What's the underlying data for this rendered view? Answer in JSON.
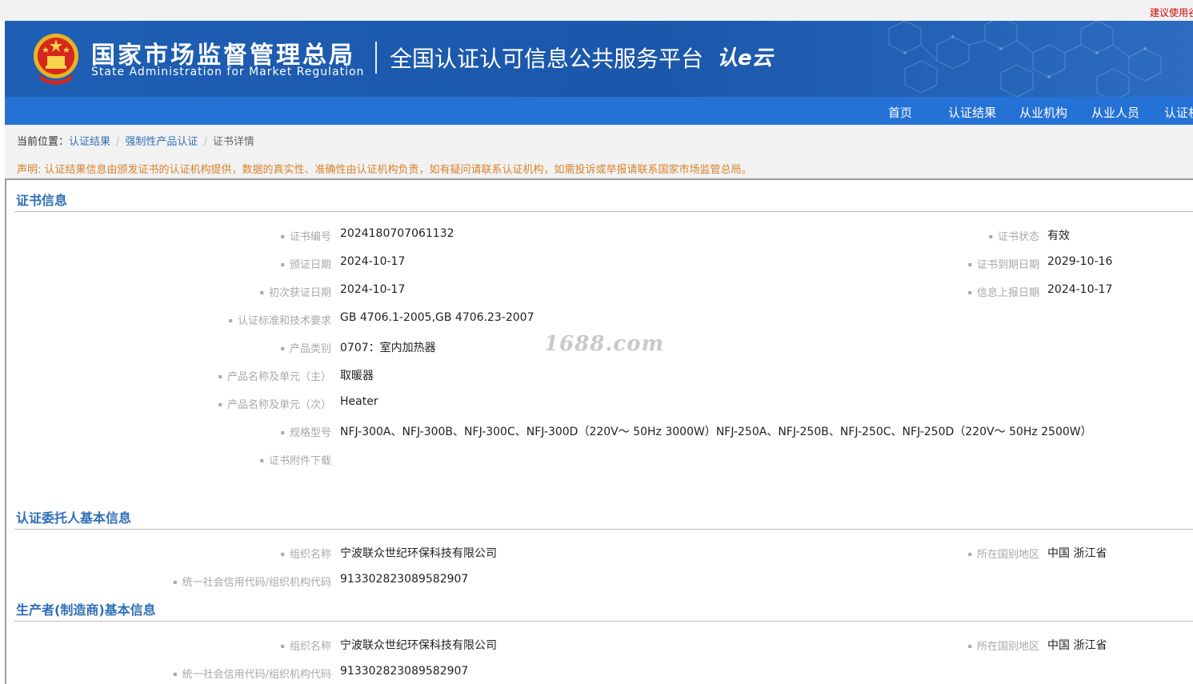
{
  "topstrip": {
    "tip": "建议使用谷"
  },
  "header": {
    "org_cn": "国家市场监督管理总局",
    "org_en": "State Administration  for  Market Regulation",
    "platform": "全国认证认可信息公共服务平台",
    "logo_text": "认e云"
  },
  "nav": {
    "items": [
      {
        "label": "首页"
      },
      {
        "label": "认证结果"
      },
      {
        "label": "从业机构"
      },
      {
        "label": "从业人员"
      },
      {
        "label": "认证机"
      }
    ]
  },
  "breadcrumb": {
    "prefix": "当前位置：",
    "items": [
      {
        "label": "认证结果"
      },
      {
        "label": "强制性产品认证"
      },
      {
        "label": "证书详情"
      }
    ]
  },
  "notice": "声明: 认证结果信息由颁发证书的认证机构提供，数据的真实性、准确性由认证机构负责，如有疑问请联系认证机构，如需投诉或举报请联系国家市场监管总局。",
  "watermark": "1688.com",
  "certificate": {
    "title": "证书信息",
    "cert_no_label": "证书编号",
    "cert_no": "2024180707061132",
    "status_label": "证书状态",
    "status": "有效",
    "issue_date_label": "颁证日期",
    "issue_date": "2024-10-17",
    "expiry_label": "证书到期日期",
    "expiry": "2029-10-16",
    "first_date_label": "初次获证日期",
    "first_date": "2024-10-17",
    "report_label": "信息上报日期",
    "report_date": "2024-10-17",
    "standard_label": "认证标准和技术要求",
    "standard": "GB 4706.1-2005,GB 4706.23-2007",
    "category_label": "产品类别",
    "category": "0707：室内加热器",
    "product_main_label": "产品名称及单元（主）",
    "product_main": "取暖器",
    "product_sub_label": "产品名称及单元（次）",
    "product_sub": "Heater",
    "model_label": "规格型号",
    "model": "NFJ-300A、NFJ-300B、NFJ-300C、NFJ-300D（220V～ 50Hz 3000W）NFJ-250A、NFJ-250B、NFJ-250C、NFJ-250D（220V～ 50Hz 2500W）",
    "attachment_label": "证书附件下载"
  },
  "client": {
    "title": "认证委托人基本信息",
    "org_label": "组织名称",
    "org": "宁波联众世纪环保科技有限公司",
    "region_label": "所在国别地区",
    "region": "中国 浙江省",
    "code_label": "统一社会信用代码/组织机构代码",
    "code": "913302823089582907"
  },
  "manufacturer": {
    "title": "生产者(制造商)基本信息",
    "org_label": "组织名称",
    "org": "宁波联众世纪环保科技有限公司",
    "region_label": "所在国别地区",
    "region": "中国 浙江省",
    "code_label": "统一社会信用代码/组织机构代码",
    "code": "913302823089582907"
  }
}
